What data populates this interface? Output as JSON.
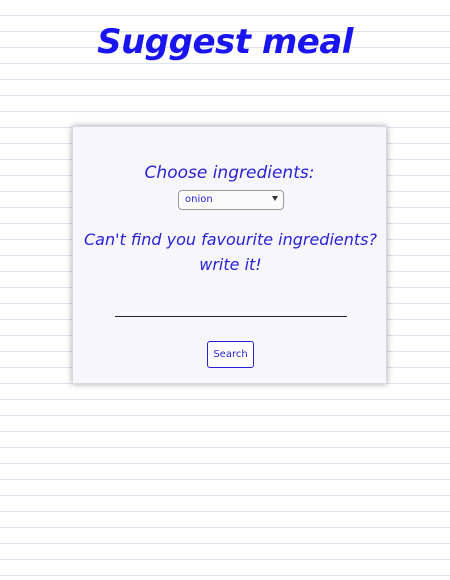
{
  "header": {
    "title": "Suggest meal"
  },
  "form": {
    "ingredients_label": "Choose ingredients:",
    "ingredients_select": {
      "selected": "onion"
    },
    "prompt_line1": "Can't find you favourite ingredients?",
    "prompt_line2": "write it!",
    "custom_ingredient": {
      "value": ""
    },
    "search_label": "Search"
  },
  "colors": {
    "accent": "#2a22d8",
    "title": "#1a14f0",
    "card_background": "#f6f6fc",
    "ruled_line": "#dde4ee"
  },
  "icons": {
    "select_arrow": "chevron-down-icon"
  }
}
